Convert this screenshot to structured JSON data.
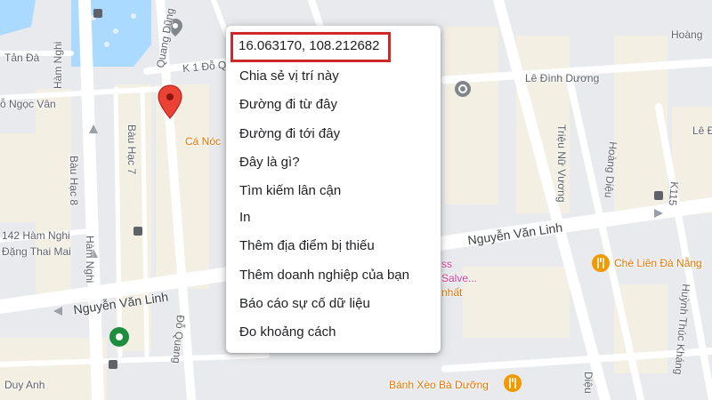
{
  "map": {
    "labels": {
      "tan_da": "Tản Đà",
      "ham_nghi_top": "Hàm Nghi",
      "quang_dung": "Quang Dũng",
      "k1": "K 1 Đỗ Q",
      "o_ngoc_van": "ỗ Ngọc Vân",
      "bau_hac_8": "Bàu Hạc 8",
      "bau_hac_7": "Bàu Hạc 7",
      "ca_noc": "Cá Nóc",
      "hoang": "Hoàng",
      "le_dinh_duong": "Lê Đình Dương",
      "le_e": "Lê Đ",
      "trieu_nu_vuong": "Triệu Nữ Vương",
      "hoang_dieu": "Hoàng Diệu",
      "k115": "K115",
      "142_ham_nghi": "142 Hàm Nghi",
      "dang_thai_mai": "Đặng Thai Mai",
      "ham_nghi_mid": "Hàm Nghi",
      "nguyen_van_linh_left": "Nguyễn Văn Linh",
      "nguyen_van_linh_right": "Nguyễn Văn Linh",
      "do_quang": "Đỗ Quang",
      "che_lien": "Chè Liên Đà Nẵng",
      "huynh_thuc_khang": "Huỳnh Thúc Kháng",
      "duy_anh": "Duy Anh",
      "banh_xeo": "Bánh Xèo Bà Dưỡng",
      "ss": "ss",
      "salve": "Salve...",
      "nhat": "nhất",
      "dieu": "Diệu"
    },
    "colors": {
      "pin": "#ea4335",
      "food": "#f29900",
      "green_poi": "#1e8e3e",
      "highlight": "#d0272b"
    }
  },
  "context_menu": {
    "coordinates": "16.063170, 108.212682",
    "items": [
      "Chia sẻ vị trí này",
      "Đường đi từ đây",
      "Đường đi tới đây",
      "Đây là gì?",
      "Tìm kiếm lân cận",
      "In",
      "Thêm địa điểm bị thiếu",
      "Thêm doanh nghiệp của bạn",
      "Báo cáo sự cố dữ liệu",
      "Đo khoảng cách"
    ]
  }
}
